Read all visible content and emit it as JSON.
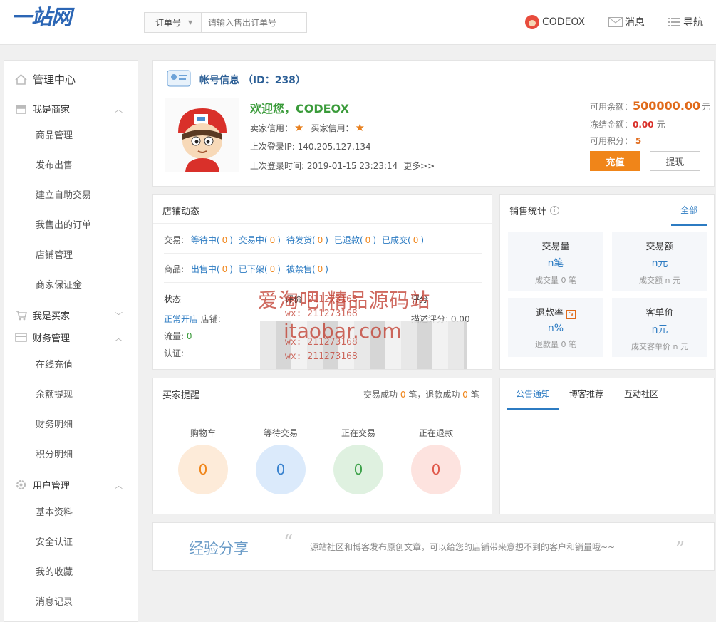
{
  "header": {
    "logo": "一站网",
    "search": {
      "type": "订单号",
      "placeholder": "请输入售出订单号"
    },
    "user": "CODEOX",
    "messages": "消息",
    "nav": "导航"
  },
  "sidebar": {
    "sections": [
      {
        "title": "管理中心",
        "items": []
      },
      {
        "title": "我是商家",
        "items": [
          "商品管理",
          "发布出售",
          "建立自助交易",
          "我售出的订单",
          "店铺管理",
          "商家保证金"
        ]
      },
      {
        "title": "我是买家",
        "items": []
      },
      {
        "title": "财务管理",
        "items": [
          "在线充值",
          "余额提现",
          "财务明细",
          "积分明细"
        ]
      },
      {
        "title": "用户管理",
        "items": [
          "基本资料",
          "安全认证",
          "我的收藏",
          "消息记录"
        ]
      }
    ]
  },
  "account": {
    "title": "帐号信息 （ID：238）",
    "welcome": "欢迎您，CODEOX",
    "seller_credit_label": "卖家信用：",
    "buyer_credit_label": "买家信用：",
    "last_ip": "上次登录IP: 140.205.127.134",
    "last_time": "上次登录时间: 2019-01-15 23:23:14",
    "more": "更多>>",
    "balance_label": "可用余额：",
    "balance": "500000.00",
    "frozen_label": "冻结金额：",
    "frozen": "0.00",
    "points_label": "可用积分：",
    "points": "5",
    "yuan": "元",
    "recharge": "充值",
    "withdraw": "提现"
  },
  "shop": {
    "title": "店铺动态",
    "trade_label": "交易:",
    "trade_items": [
      {
        "l": "等待中",
        "n": "0"
      },
      {
        "l": "交易中",
        "n": "0"
      },
      {
        "l": "待发货",
        "n": "0"
      },
      {
        "l": "已退款",
        "n": "0"
      },
      {
        "l": "已成交",
        "n": "0"
      }
    ],
    "goods_label": "商品:",
    "goods_items": [
      {
        "l": "出售中",
        "n": "0"
      },
      {
        "l": "已下架",
        "n": "0"
      },
      {
        "l": "被禁售",
        "n": "0"
      }
    ],
    "status": "状态",
    "rating_label": "评价",
    "score_label": "评分",
    "open": "正常开店",
    "shop_label": "店铺:",
    "desc_score": "描述评分: 0.00",
    "traffic_label": "流量:",
    "traffic": "0",
    "cert": "认证:"
  },
  "sales": {
    "title": "销售统计",
    "all": "全部",
    "boxes": [
      {
        "t": "交易量",
        "v": "n笔",
        "s": "成交量 0 笔"
      },
      {
        "t": "交易额",
        "v": "n元",
        "s": "成交额 n 元"
      },
      {
        "t": "退款率",
        "v": "n%",
        "s": "退款量 0 笔"
      },
      {
        "t": "客单价",
        "v": "n元",
        "s": "成交客单价 n 元"
      }
    ]
  },
  "buyer": {
    "title": "买家提醒",
    "summary_a": "交易成功",
    "summary_n1": "0",
    "summary_b": "笔，退款成功",
    "summary_n2": "0",
    "summary_c": "笔",
    "items": [
      {
        "label": "购物车",
        "value": "0",
        "bg": "#fdebd9",
        "fg": "#f08519"
      },
      {
        "label": "等待交易",
        "value": "0",
        "bg": "#dbeafb",
        "fg": "#3a83cf"
      },
      {
        "label": "正在交易",
        "value": "0",
        "bg": "#dff1e0",
        "fg": "#3ea24b"
      },
      {
        "label": "正在退款",
        "value": "0",
        "bg": "#fde3df",
        "fg": "#e0584a"
      }
    ]
  },
  "notice": {
    "tabs": [
      "公告通知",
      "博客推荐",
      "互动社区"
    ]
  },
  "share": {
    "title": "经验分享",
    "text": "源站社区和博客发布原创文章，可以给您的店铺带来意想不到的客户和销量哦~~"
  },
  "watermark": {
    "line1": "爱淘吧|精品源码站",
    "line2": "wx: 211273168",
    "line3": "itaobar.com"
  },
  "colors": {
    "accent": "#f08519",
    "link": "#2c7bc2",
    "logo": "#2c66b5",
    "welcome": "#3a9b3a",
    "price": "#e06a1a"
  }
}
